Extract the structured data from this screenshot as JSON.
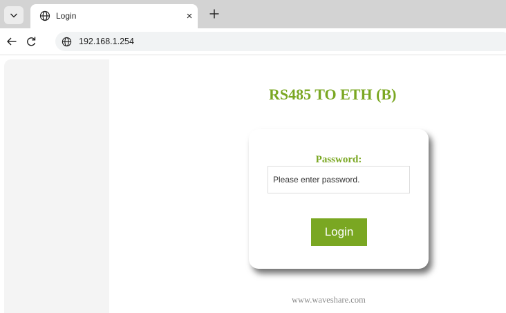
{
  "browser": {
    "tab": {
      "title": "Login",
      "close": "×"
    },
    "address_bar": {
      "url": "192.168.1.254"
    }
  },
  "page": {
    "heading": "RS485 TO ETH (B)",
    "password_label": "Password:",
    "password_placeholder": "Please enter password.",
    "login_label": "Login",
    "footer": "www.waveshare.com"
  },
  "colors": {
    "accent": "#7aa722",
    "tabstrip": "#d3d3d3",
    "sidebar": "#f4f4f4"
  },
  "icons": {
    "tab_list": "chevron-down-icon",
    "tab_favicon": "globe-icon",
    "new_tab": "plus-icon",
    "back": "arrow-left-icon",
    "reload": "reload-icon",
    "site_info": "globe-icon"
  }
}
